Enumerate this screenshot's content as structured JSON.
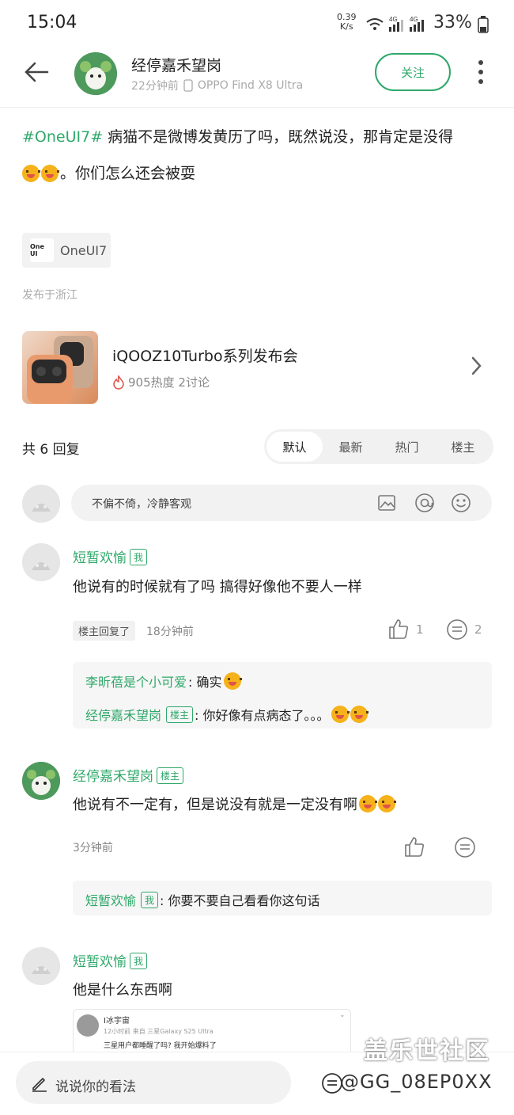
{
  "status_bar": {
    "time": "15:04",
    "net_speed_value": "0.39",
    "net_speed_unit": "K/s",
    "signal_1": "4G",
    "signal_2": "4G",
    "battery": "33%"
  },
  "header": {
    "author_name": "经停嘉禾望岗",
    "post_time": "22分钟前",
    "device": "OPPO Find X8 Ultra",
    "follow_label": "关注"
  },
  "post": {
    "line1_hashtag": "#OneUI7#",
    "line1_text": "病猫不是微博发黄历了吗，既然说没，那肯定是没得",
    "line2_text": "。你们怎么还会被耍",
    "topic_logo": "One UI",
    "topic_label": "OneUI7",
    "location": "发布于浙江"
  },
  "event": {
    "title": "iQOOZ10Turbo系列发布会",
    "heat": "905热度 2讨论"
  },
  "replies": {
    "count_label": "共 6 回复",
    "sort_tabs": [
      "默认",
      "最新",
      "热门",
      "楼主"
    ],
    "input_placeholder": "不偏不倚，冷静客观"
  },
  "comments": [
    {
      "name": "短暂欢愉",
      "badge": "我",
      "text": "他说有的时候就有了吗 搞得好像他不要人一样",
      "chip": "楼主回复了",
      "time": "18分钟前",
      "likes": "1",
      "reply_count": "2",
      "sub1_name": "李昕蓓是个小可爱",
      "sub1_text": ": 确实",
      "sub2_name": "经停嘉禾望岗",
      "sub2_badge": "楼主",
      "sub2_text": ": 你好像有点病态了。。。"
    },
    {
      "name": "经停嘉禾望岗",
      "badge": "楼主",
      "text": "他说有不一定有，但是说没有就是一定没有啊",
      "time": "3分钟前",
      "sub1_name": "短暂欢愉",
      "sub1_badge": "我",
      "sub1_text": ": 你要不要自己看看你这句话"
    },
    {
      "name": "短暂欢愉",
      "badge": "我",
      "text": "他是什么东西啊",
      "shot_name": "I冰宇宙",
      "shot_meta": "12小时前 来自 三星Galaxy S25 Ultra",
      "shot_text": "三星用户都睡醒了吗? 我开始爆料了"
    }
  ],
  "bottom": {
    "input_placeholder": "说说你的看法",
    "watermark": "盖乐世社区",
    "user_id": "@GG_08EP0XX"
  },
  "colors": {
    "accent": "#2fa86a"
  }
}
